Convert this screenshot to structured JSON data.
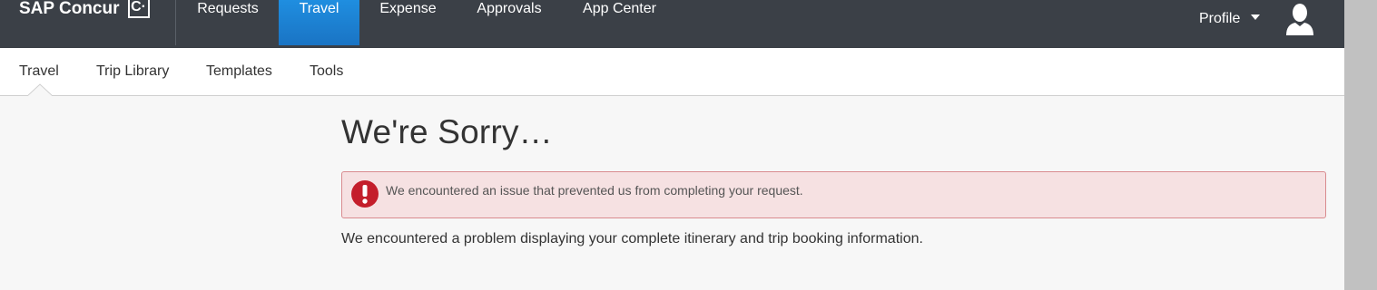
{
  "header": {
    "logo_text": "SAP Concur",
    "logo_mark": "C·",
    "nav": [
      {
        "label": "Requests"
      },
      {
        "label": "Travel",
        "active": true
      },
      {
        "label": "Expense"
      },
      {
        "label": "Approvals"
      },
      {
        "label": "App Center"
      }
    ],
    "profile_label": "Profile"
  },
  "subnav": {
    "items": [
      {
        "label": "Travel",
        "active": true
      },
      {
        "label": "Trip Library"
      },
      {
        "label": "Templates"
      },
      {
        "label": "Tools"
      }
    ]
  },
  "main": {
    "heading": "We're Sorry…",
    "alert_message": "We encountered an issue that prevented us from completing your request.",
    "body_text": "We encountered a problem displaying your complete itinerary and trip booking information."
  },
  "colors": {
    "topbar": "#3b4047",
    "active_tab": "#1a74c4",
    "alert_bg": "#f6e1e2",
    "alert_icon": "#c41e2b"
  },
  "icons": {
    "avatar": "user-avatar-icon",
    "alert": "exclamation-circle-icon",
    "profile_caret": "chevron-down-icon"
  }
}
